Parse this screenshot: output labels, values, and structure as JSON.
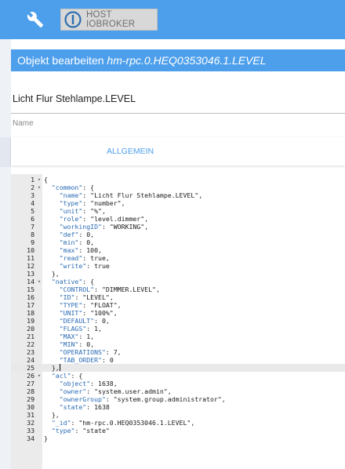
{
  "header": {
    "wrench_icon": "wrench-icon",
    "host_button_label": "HOST IOBROKER",
    "host_logo_icon": "iobroker-logo-icon",
    "colors": {
      "bar": "#4d9fec",
      "host_bg": "#d8d8d8"
    }
  },
  "dialog": {
    "title_prefix": "Objekt bearbeiten",
    "title_object": "hm-rpc.0.HEQ0353046.1.LEVEL",
    "name_value": "Licht Flur Stehlampe.LEVEL",
    "name_label": "Name",
    "tabs": [
      {
        "label": "ALLGEMEIN"
      }
    ]
  },
  "editor": {
    "active_line": 25,
    "lines": [
      {
        "n": "1",
        "fold": "▾",
        "tokens": [
          [
            "p",
            "{"
          ]
        ]
      },
      {
        "n": "2",
        "fold": "▾",
        "tokens": [
          [
            "p",
            "  "
          ],
          [
            "k",
            "\"common\""
          ],
          [
            "p",
            ": {"
          ]
        ]
      },
      {
        "n": "3",
        "fold": "",
        "tokens": [
          [
            "p",
            "    "
          ],
          [
            "k",
            "\"name\""
          ],
          [
            "p",
            ": "
          ],
          [
            "s",
            "\"Licht Flur Stehlampe.LEVEL\""
          ],
          [
            "p",
            ","
          ]
        ]
      },
      {
        "n": "4",
        "fold": "",
        "tokens": [
          [
            "p",
            "    "
          ],
          [
            "k",
            "\"type\""
          ],
          [
            "p",
            ": "
          ],
          [
            "s",
            "\"number\""
          ],
          [
            "p",
            ","
          ]
        ]
      },
      {
        "n": "5",
        "fold": "",
        "tokens": [
          [
            "p",
            "    "
          ],
          [
            "k",
            "\"unit\""
          ],
          [
            "p",
            ": "
          ],
          [
            "s",
            "\"%\""
          ],
          [
            "p",
            ","
          ]
        ]
      },
      {
        "n": "6",
        "fold": "",
        "tokens": [
          [
            "p",
            "    "
          ],
          [
            "k",
            "\"role\""
          ],
          [
            "p",
            ": "
          ],
          [
            "s",
            "\"level.dimmer\""
          ],
          [
            "p",
            ","
          ]
        ]
      },
      {
        "n": "7",
        "fold": "",
        "tokens": [
          [
            "p",
            "    "
          ],
          [
            "k",
            "\"workingID\""
          ],
          [
            "p",
            ": "
          ],
          [
            "s",
            "\"WORKING\""
          ],
          [
            "p",
            ","
          ]
        ]
      },
      {
        "n": "8",
        "fold": "",
        "tokens": [
          [
            "p",
            "    "
          ],
          [
            "k",
            "\"def\""
          ],
          [
            "p",
            ": "
          ],
          [
            "n",
            "0"
          ],
          [
            "p",
            ","
          ]
        ]
      },
      {
        "n": "9",
        "fold": "",
        "tokens": [
          [
            "p",
            "    "
          ],
          [
            "k",
            "\"min\""
          ],
          [
            "p",
            ": "
          ],
          [
            "n",
            "0"
          ],
          [
            "p",
            ","
          ]
        ]
      },
      {
        "n": "10",
        "fold": "",
        "tokens": [
          [
            "p",
            "    "
          ],
          [
            "k",
            "\"max\""
          ],
          [
            "p",
            ": "
          ],
          [
            "n",
            "100"
          ],
          [
            "p",
            ","
          ]
        ]
      },
      {
        "n": "11",
        "fold": "",
        "tokens": [
          [
            "p",
            "    "
          ],
          [
            "k",
            "\"read\""
          ],
          [
            "p",
            ": "
          ],
          [
            "b",
            "true"
          ],
          [
            "p",
            ","
          ]
        ]
      },
      {
        "n": "12",
        "fold": "",
        "tokens": [
          [
            "p",
            "    "
          ],
          [
            "k",
            "\"write\""
          ],
          [
            "p",
            ": "
          ],
          [
            "b",
            "true"
          ]
        ]
      },
      {
        "n": "13",
        "fold": "",
        "tokens": [
          [
            "p",
            "  },"
          ]
        ]
      },
      {
        "n": "14",
        "fold": "▾",
        "tokens": [
          [
            "p",
            "  "
          ],
          [
            "k",
            "\"native\""
          ],
          [
            "p",
            ": {"
          ]
        ]
      },
      {
        "n": "15",
        "fold": "",
        "tokens": [
          [
            "p",
            "    "
          ],
          [
            "k",
            "\"CONTROL\""
          ],
          [
            "p",
            ": "
          ],
          [
            "s",
            "\"DIMMER.LEVEL\""
          ],
          [
            "p",
            ","
          ]
        ]
      },
      {
        "n": "16",
        "fold": "",
        "tokens": [
          [
            "p",
            "    "
          ],
          [
            "k",
            "\"ID\""
          ],
          [
            "p",
            ": "
          ],
          [
            "s",
            "\"LEVEL\""
          ],
          [
            "p",
            ","
          ]
        ]
      },
      {
        "n": "17",
        "fold": "",
        "tokens": [
          [
            "p",
            "    "
          ],
          [
            "k",
            "\"TYPE\""
          ],
          [
            "p",
            ": "
          ],
          [
            "s",
            "\"FLOAT\""
          ],
          [
            "p",
            ","
          ]
        ]
      },
      {
        "n": "18",
        "fold": "",
        "tokens": [
          [
            "p",
            "    "
          ],
          [
            "k",
            "\"UNIT\""
          ],
          [
            "p",
            ": "
          ],
          [
            "s",
            "\"100%\""
          ],
          [
            "p",
            ","
          ]
        ]
      },
      {
        "n": "19",
        "fold": "",
        "tokens": [
          [
            "p",
            "    "
          ],
          [
            "k",
            "\"DEFAULT\""
          ],
          [
            "p",
            ": "
          ],
          [
            "n",
            "0"
          ],
          [
            "p",
            ","
          ]
        ]
      },
      {
        "n": "20",
        "fold": "",
        "tokens": [
          [
            "p",
            "    "
          ],
          [
            "k",
            "\"FLAGS\""
          ],
          [
            "p",
            ": "
          ],
          [
            "n",
            "1"
          ],
          [
            "p",
            ","
          ]
        ]
      },
      {
        "n": "21",
        "fold": "",
        "tokens": [
          [
            "p",
            "    "
          ],
          [
            "k",
            "\"MAX\""
          ],
          [
            "p",
            ": "
          ],
          [
            "n",
            "1"
          ],
          [
            "p",
            ","
          ]
        ]
      },
      {
        "n": "22",
        "fold": "",
        "tokens": [
          [
            "p",
            "    "
          ],
          [
            "k",
            "\"MIN\""
          ],
          [
            "p",
            ": "
          ],
          [
            "n",
            "0"
          ],
          [
            "p",
            ","
          ]
        ]
      },
      {
        "n": "23",
        "fold": "",
        "tokens": [
          [
            "p",
            "    "
          ],
          [
            "k",
            "\"OPERATIONS\""
          ],
          [
            "p",
            ": "
          ],
          [
            "n",
            "7"
          ],
          [
            "p",
            ","
          ]
        ]
      },
      {
        "n": "24",
        "fold": "",
        "tokens": [
          [
            "p",
            "    "
          ],
          [
            "k",
            "\"TAB_ORDER\""
          ],
          [
            "p",
            ": "
          ],
          [
            "n",
            "0"
          ]
        ]
      },
      {
        "n": "25",
        "fold": "",
        "tokens": [
          [
            "p",
            "  },"
          ]
        ]
      },
      {
        "n": "26",
        "fold": "▾",
        "tokens": [
          [
            "p",
            "  "
          ],
          [
            "k",
            "\"acl\""
          ],
          [
            "p",
            ": {"
          ]
        ]
      },
      {
        "n": "27",
        "fold": "",
        "tokens": [
          [
            "p",
            "    "
          ],
          [
            "k",
            "\"object\""
          ],
          [
            "p",
            ": "
          ],
          [
            "n",
            "1638"
          ],
          [
            "p",
            ","
          ]
        ]
      },
      {
        "n": "28",
        "fold": "",
        "tokens": [
          [
            "p",
            "    "
          ],
          [
            "k",
            "\"owner\""
          ],
          [
            "p",
            ": "
          ],
          [
            "s",
            "\"system.user.admin\""
          ],
          [
            "p",
            ","
          ]
        ]
      },
      {
        "n": "29",
        "fold": "",
        "tokens": [
          [
            "p",
            "    "
          ],
          [
            "k",
            "\"ownerGroup\""
          ],
          [
            "p",
            ": "
          ],
          [
            "s",
            "\"system.group.administrator\""
          ],
          [
            "p",
            ","
          ]
        ]
      },
      {
        "n": "30",
        "fold": "",
        "tokens": [
          [
            "p",
            "    "
          ],
          [
            "k",
            "\"state\""
          ],
          [
            "p",
            ": "
          ],
          [
            "n",
            "1638"
          ]
        ]
      },
      {
        "n": "31",
        "fold": "",
        "tokens": [
          [
            "p",
            "  },"
          ]
        ]
      },
      {
        "n": "32",
        "fold": "",
        "tokens": [
          [
            "p",
            "  "
          ],
          [
            "k",
            "\"_id\""
          ],
          [
            "p",
            ": "
          ],
          [
            "s",
            "\"hm-rpc.0.HEQ0353046.1.LEVEL\""
          ],
          [
            "p",
            ","
          ]
        ]
      },
      {
        "n": "33",
        "fold": "",
        "tokens": [
          [
            "p",
            "  "
          ],
          [
            "k",
            "\"type\""
          ],
          [
            "p",
            ": "
          ],
          [
            "s",
            "\"state\""
          ]
        ]
      },
      {
        "n": "34",
        "fold": "",
        "tokens": [
          [
            "p",
            "}"
          ]
        ]
      }
    ]
  }
}
